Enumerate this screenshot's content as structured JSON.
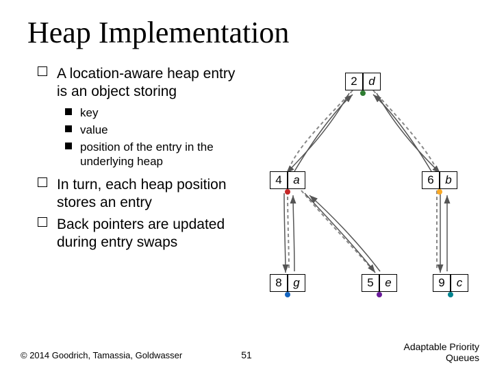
{
  "title": "Heap Implementation",
  "bullets": {
    "b1": "A location-aware heap entry is an object storing",
    "b1a": "key",
    "b1b": "value",
    "b1c": "position of the entry in the underlying heap",
    "b2": "In turn, each heap position stores an entry",
    "b3": "Back pointers are updated during entry swaps"
  },
  "copyright": "© 2014 Goodrich, Tamassia, Goldwasser",
  "pagenum": "51",
  "footer": "Adaptable Priority Queues",
  "nodes": {
    "d": {
      "k": "2",
      "v": "d",
      "color": "#2e7d32"
    },
    "a": {
      "k": "4",
      "v": "a",
      "color": "#c62828"
    },
    "b": {
      "k": "6",
      "v": "b",
      "color": "#f9a825"
    },
    "g": {
      "k": "8",
      "v": "g",
      "color": "#1565c0"
    },
    "e": {
      "k": "5",
      "v": "e",
      "color": "#6a1b9a"
    },
    "c": {
      "k": "9",
      "v": "c",
      "color": "#00838f"
    }
  }
}
